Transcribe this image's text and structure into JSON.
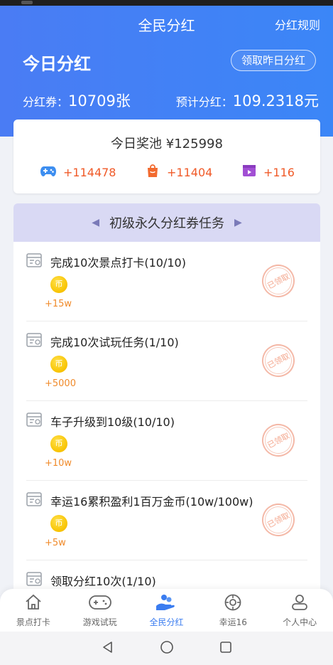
{
  "header": {
    "title": "全民分红",
    "rules": "分红规则",
    "today_label": "今日分红",
    "claim_button": "领取昨日分红",
    "coupon_label": "分红券：",
    "coupon_value": "10709张",
    "estimate_label": "预计分红：",
    "estimate_value": "109.2318元"
  },
  "pool": {
    "title": "今日奖池 ¥125998",
    "stats": [
      {
        "icon": "gamepad-icon",
        "value": "+114478",
        "color": "#3d8ef0"
      },
      {
        "icon": "shopping-bag-icon",
        "value": "+11404",
        "color": "#f26a2f"
      },
      {
        "icon": "video-icon",
        "value": "+116",
        "color": "#a24fd4"
      }
    ]
  },
  "tasks": {
    "heading": "初级永久分红券任务",
    "coin_label": "币",
    "stamp_label": "已领取",
    "items": [
      {
        "name": "完成10次景点打卡(10/10)",
        "reward": "+15w"
      },
      {
        "name": "完成10次试玩任务(1/10)",
        "reward": "+5000"
      },
      {
        "name": "车子升级到10级(10/10)",
        "reward": "+10w"
      },
      {
        "name": "幸运16累积盈利1百万金币(10w/100w)",
        "reward": "+5w"
      },
      {
        "name": "领取分红10次(1/10)",
        "reward": ""
      }
    ]
  },
  "tabbar": {
    "tabs": [
      {
        "label": "景点打卡",
        "icon": "house-icon"
      },
      {
        "label": "游戏试玩",
        "icon": "gamepad-icon"
      },
      {
        "label": "全民分红",
        "icon": "hand-coins-icon",
        "active": true
      },
      {
        "label": "幸运16",
        "icon": "wheel-icon"
      },
      {
        "label": "个人中心",
        "icon": "person-icon"
      }
    ]
  },
  "colors": {
    "primary_blue": "#3b86f7",
    "accent_orange": "#f05a28",
    "panel_purple": "#d9d9f4"
  }
}
